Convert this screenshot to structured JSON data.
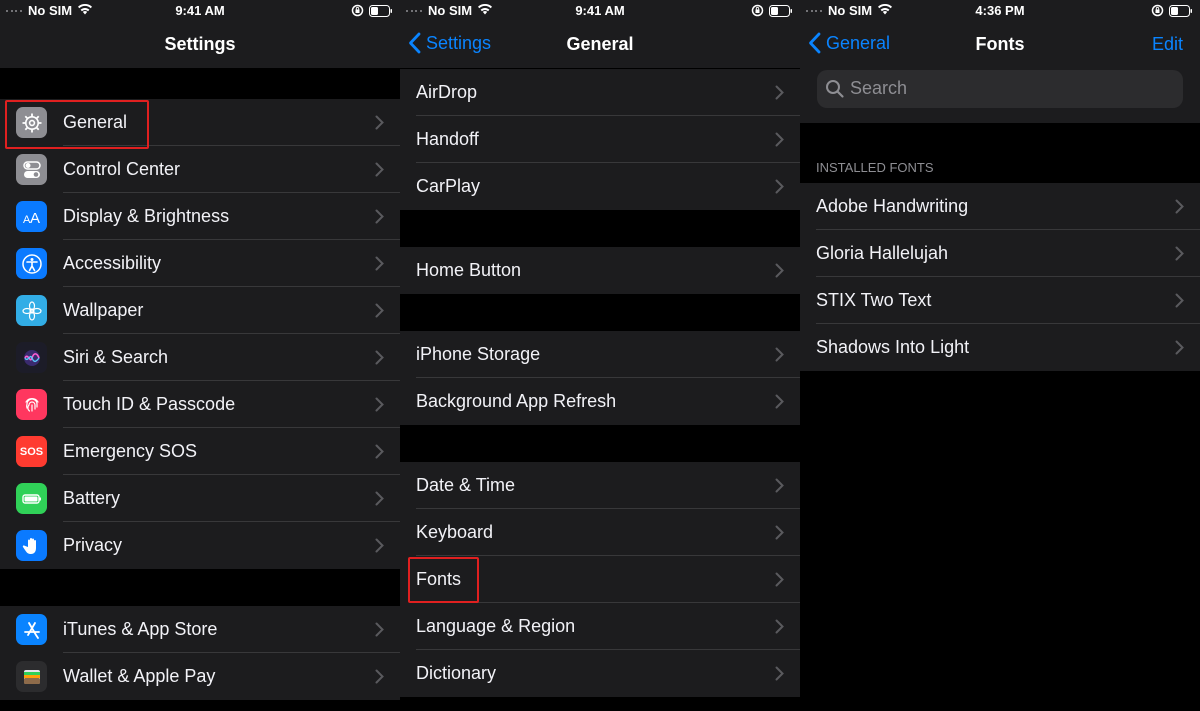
{
  "status": {
    "carrier": "No SIM",
    "time_1": "9:41 AM",
    "time_2": "9:41 AM",
    "time_3": "4:36 PM"
  },
  "screen1": {
    "title": "Settings",
    "group1": [
      {
        "label": "General",
        "icon": "gear-icon",
        "color": "#8e8e93"
      },
      {
        "label": "Control Center",
        "icon": "toggles-icon",
        "color": "#8e8e93"
      },
      {
        "label": "Display & Brightness",
        "icon": "text-size-icon",
        "color": "#0a7aff"
      },
      {
        "label": "Accessibility",
        "icon": "accessibility-icon",
        "color": "#0a7aff"
      },
      {
        "label": "Wallpaper",
        "icon": "flower-icon",
        "color": "#32ade6"
      },
      {
        "label": "Siri & Search",
        "icon": "siri-icon",
        "color": "#1c1c28"
      },
      {
        "label": "Touch ID & Passcode",
        "icon": "fingerprint-icon",
        "color": "#ff375f"
      },
      {
        "label": "Emergency SOS",
        "icon": "sos-icon",
        "color": "#ff3b30",
        "badge": "SOS"
      },
      {
        "label": "Battery",
        "icon": "battery-icon",
        "color": "#30d158"
      },
      {
        "label": "Privacy",
        "icon": "hand-icon",
        "color": "#0a7aff"
      }
    ],
    "group2": [
      {
        "label": "iTunes & App Store",
        "icon": "app-store-icon",
        "color": "#0a84ff"
      },
      {
        "label": "Wallet & Apple Pay",
        "icon": "wallet-icon",
        "color": "#2c2c2e"
      }
    ]
  },
  "screen2": {
    "back": "Settings",
    "title": "General",
    "group1": [
      "AirDrop",
      "Handoff",
      "CarPlay"
    ],
    "group2": [
      "Home Button"
    ],
    "group3": [
      "iPhone Storage",
      "Background App Refresh"
    ],
    "group4": [
      "Date & Time",
      "Keyboard",
      "Fonts",
      "Language & Region",
      "Dictionary"
    ]
  },
  "screen3": {
    "back": "General",
    "title": "Fonts",
    "edit": "Edit",
    "search_placeholder": "Search",
    "section_header": "INSTALLED FONTS",
    "fonts": [
      "Adobe Handwriting",
      "Gloria Hallelujah",
      "STIX Two Text",
      "Shadows Into Light"
    ]
  },
  "colors": {
    "accent": "#0a84ff",
    "highlight": "#e02020",
    "cell": "#1c1c1e"
  }
}
